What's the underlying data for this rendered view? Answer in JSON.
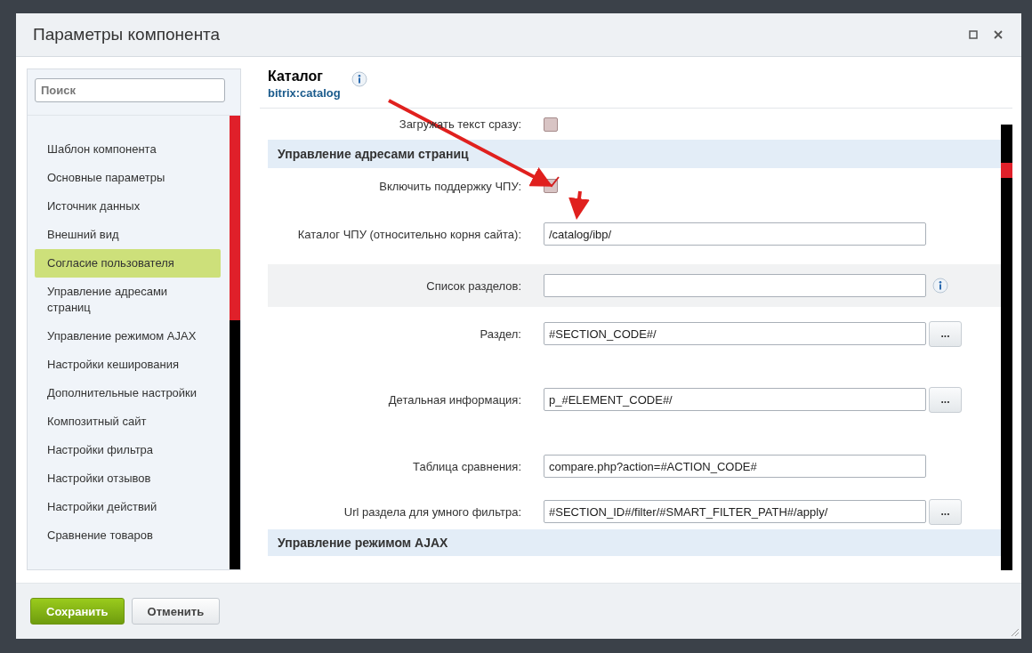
{
  "window": {
    "title": "Параметры компонента"
  },
  "search": {
    "placeholder": "Поиск"
  },
  "sidebar": {
    "items": [
      {
        "label": "Шаблон компонента",
        "selected": false
      },
      {
        "label": "Основные параметры",
        "selected": false
      },
      {
        "label": "Источник данных",
        "selected": false
      },
      {
        "label": "Внешний вид",
        "selected": false
      },
      {
        "label": "Согласие пользователя",
        "selected": true
      },
      {
        "label": "Управление адресами страниц",
        "selected": false
      },
      {
        "label": "Управление режимом AJAX",
        "selected": false
      },
      {
        "label": "Настройки кеширования",
        "selected": false
      },
      {
        "label": "Дополнительные настройки",
        "selected": false
      },
      {
        "label": "Композитный сайт",
        "selected": false
      },
      {
        "label": "Настройки фильтра",
        "selected": false
      },
      {
        "label": "Настройки отзывов",
        "selected": false
      },
      {
        "label": "Настройки действий",
        "selected": false
      },
      {
        "label": "Сравнение товаров",
        "selected": false
      }
    ]
  },
  "component": {
    "title": "Каталог",
    "code": "bitrix:catalog"
  },
  "rows": [
    {
      "kind": "checkbox",
      "label": "Загружать текст сразу:",
      "checked": false
    },
    {
      "kind": "section",
      "label": "Управление адресами страниц"
    },
    {
      "kind": "checkbox",
      "label": "Включить поддержку ЧПУ:",
      "checked": true
    },
    {
      "kind": "text",
      "label": "Каталог ЧПУ (относительно корня сайта):",
      "value": "/catalog/ibp/"
    },
    {
      "kind": "text",
      "label": "Список разделов:",
      "value": "",
      "info": true,
      "shaded": true
    },
    {
      "kind": "text",
      "label": "Раздел:",
      "value": "#SECTION_CODE#/",
      "button": "..."
    },
    {
      "kind": "text",
      "label": "Детальная информация:",
      "value": "p_#ELEMENT_CODE#/",
      "button": "..."
    },
    {
      "kind": "text",
      "label": "Таблица сравнения:",
      "value": "compare.php?action=#ACTION_CODE#"
    },
    {
      "kind": "text",
      "label": "Url раздела для умного фильтра:",
      "value": "#SECTION_ID#/filter/#SMART_FILTER_PATH#/apply/",
      "button": "..."
    },
    {
      "kind": "section",
      "label": "Управление режимом AJAX"
    }
  ],
  "buttons": [
    {
      "label": "Сохранить",
      "kind": "primary"
    },
    {
      "label": "Отменить",
      "kind": "secondary"
    }
  ]
}
